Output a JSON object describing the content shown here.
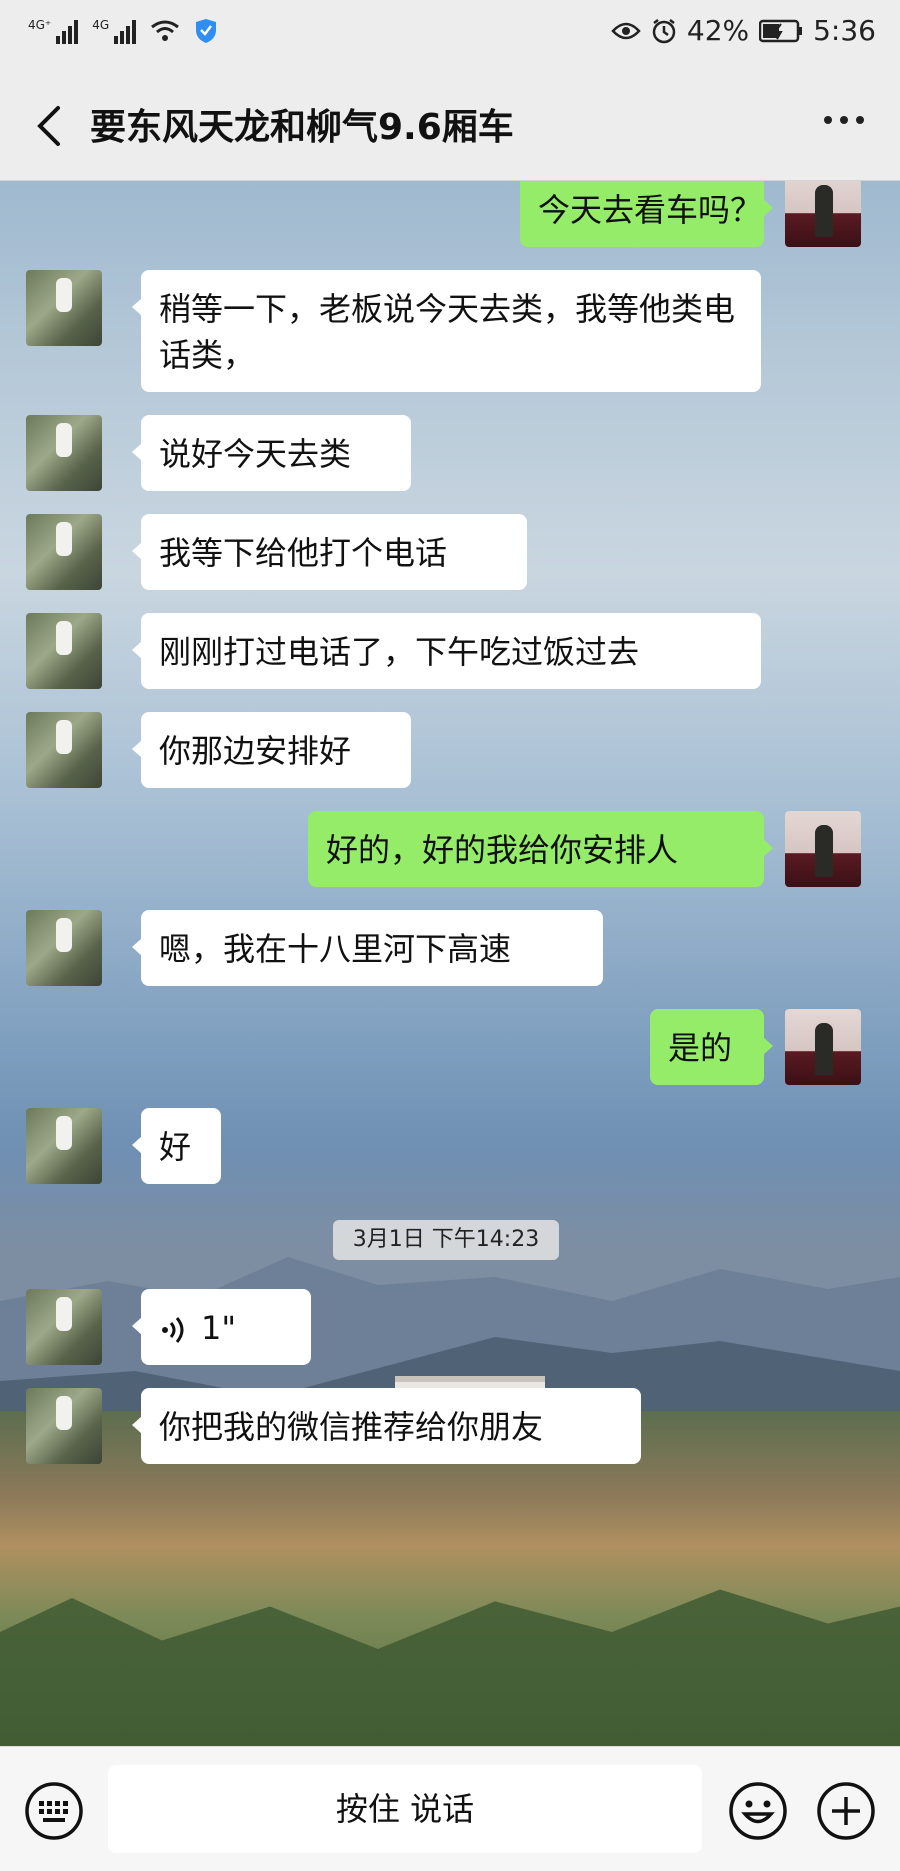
{
  "status_bar": {
    "network1": "4G⁺",
    "network2": "4G",
    "battery_percent": "42%",
    "time": "5:36"
  },
  "header": {
    "title": "要东风天龙和柳气9.6厢车",
    "back_icon": "chevron-left-icon",
    "more_icon": "more-dots-icon"
  },
  "messages": [
    {
      "side": "self",
      "text": "今天去看车吗？"
    },
    {
      "side": "other",
      "text": "稍等一下，老板说今天去类，我等他类电话类，"
    },
    {
      "side": "other",
      "text": "说好今天去类"
    },
    {
      "side": "other",
      "text": "我等下给他打个电话"
    },
    {
      "side": "other",
      "text": "刚刚打过电话了，下午吃过饭过去"
    },
    {
      "side": "other",
      "text": "你那边安排好"
    },
    {
      "side": "self",
      "text": "好的，好的我给你安排人"
    },
    {
      "side": "other",
      "text": "嗯，我在十八里河下高速"
    },
    {
      "side": "self",
      "text": "是的"
    },
    {
      "side": "other",
      "text": "好"
    },
    {
      "side": "other",
      "type": "voice",
      "text": "1\""
    },
    {
      "side": "other",
      "text": "你把我的微信推荐给你朋友"
    }
  ],
  "timestamp": "3月1日 下午14:23",
  "input_bar": {
    "hold_to_talk": "按住 说话",
    "keyboard_icon": "keyboard-icon",
    "emoji_icon": "emoji-icon",
    "plus_icon": "plus-icon"
  },
  "colors": {
    "self_bubble": "#95ec69",
    "other_bubble": "#ffffff",
    "bar_bg": "#ededed"
  }
}
